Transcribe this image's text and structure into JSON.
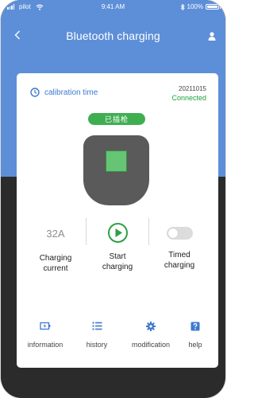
{
  "colors": {
    "header_blue": "#5d8fd8",
    "accent_blue": "#3f78d0",
    "status_green": "#1d9e3c",
    "badge_green": "#3fae51",
    "charger_gray": "#5a5a5a",
    "phone_dark": "#2b2b2b"
  },
  "status_bar": {
    "carrier": "pilot",
    "time": "9:41 AM",
    "battery_text": "100%",
    "battery_level": 1.0,
    "icons": [
      "signal-icon",
      "wifi-icon",
      "bluetooth-icon",
      "battery-icon"
    ]
  },
  "nav": {
    "title": "Bluetooth charging",
    "back_icon": "chevron-left-icon",
    "user_icon": "user-icon"
  },
  "card": {
    "calibration_label": "calibration time",
    "calibration_icon": "clock-icon",
    "date": "20211015",
    "connection_status": "Connected",
    "badge_text": "已插枪",
    "charger_icon": "charger-icon",
    "controls": {
      "current_value": "32A",
      "current_label": "Charging current",
      "start_label": "Start charging",
      "start_icon": "play-icon",
      "timed_label": "Timed charging",
      "timed_enabled": false
    },
    "tabs": [
      {
        "label": "information",
        "icon": "battery-info-icon"
      },
      {
        "label": "history",
        "icon": "list-icon"
      },
      {
        "label": "modification",
        "icon": "gear-icon"
      },
      {
        "label": "help",
        "icon": "help-icon"
      }
    ]
  }
}
